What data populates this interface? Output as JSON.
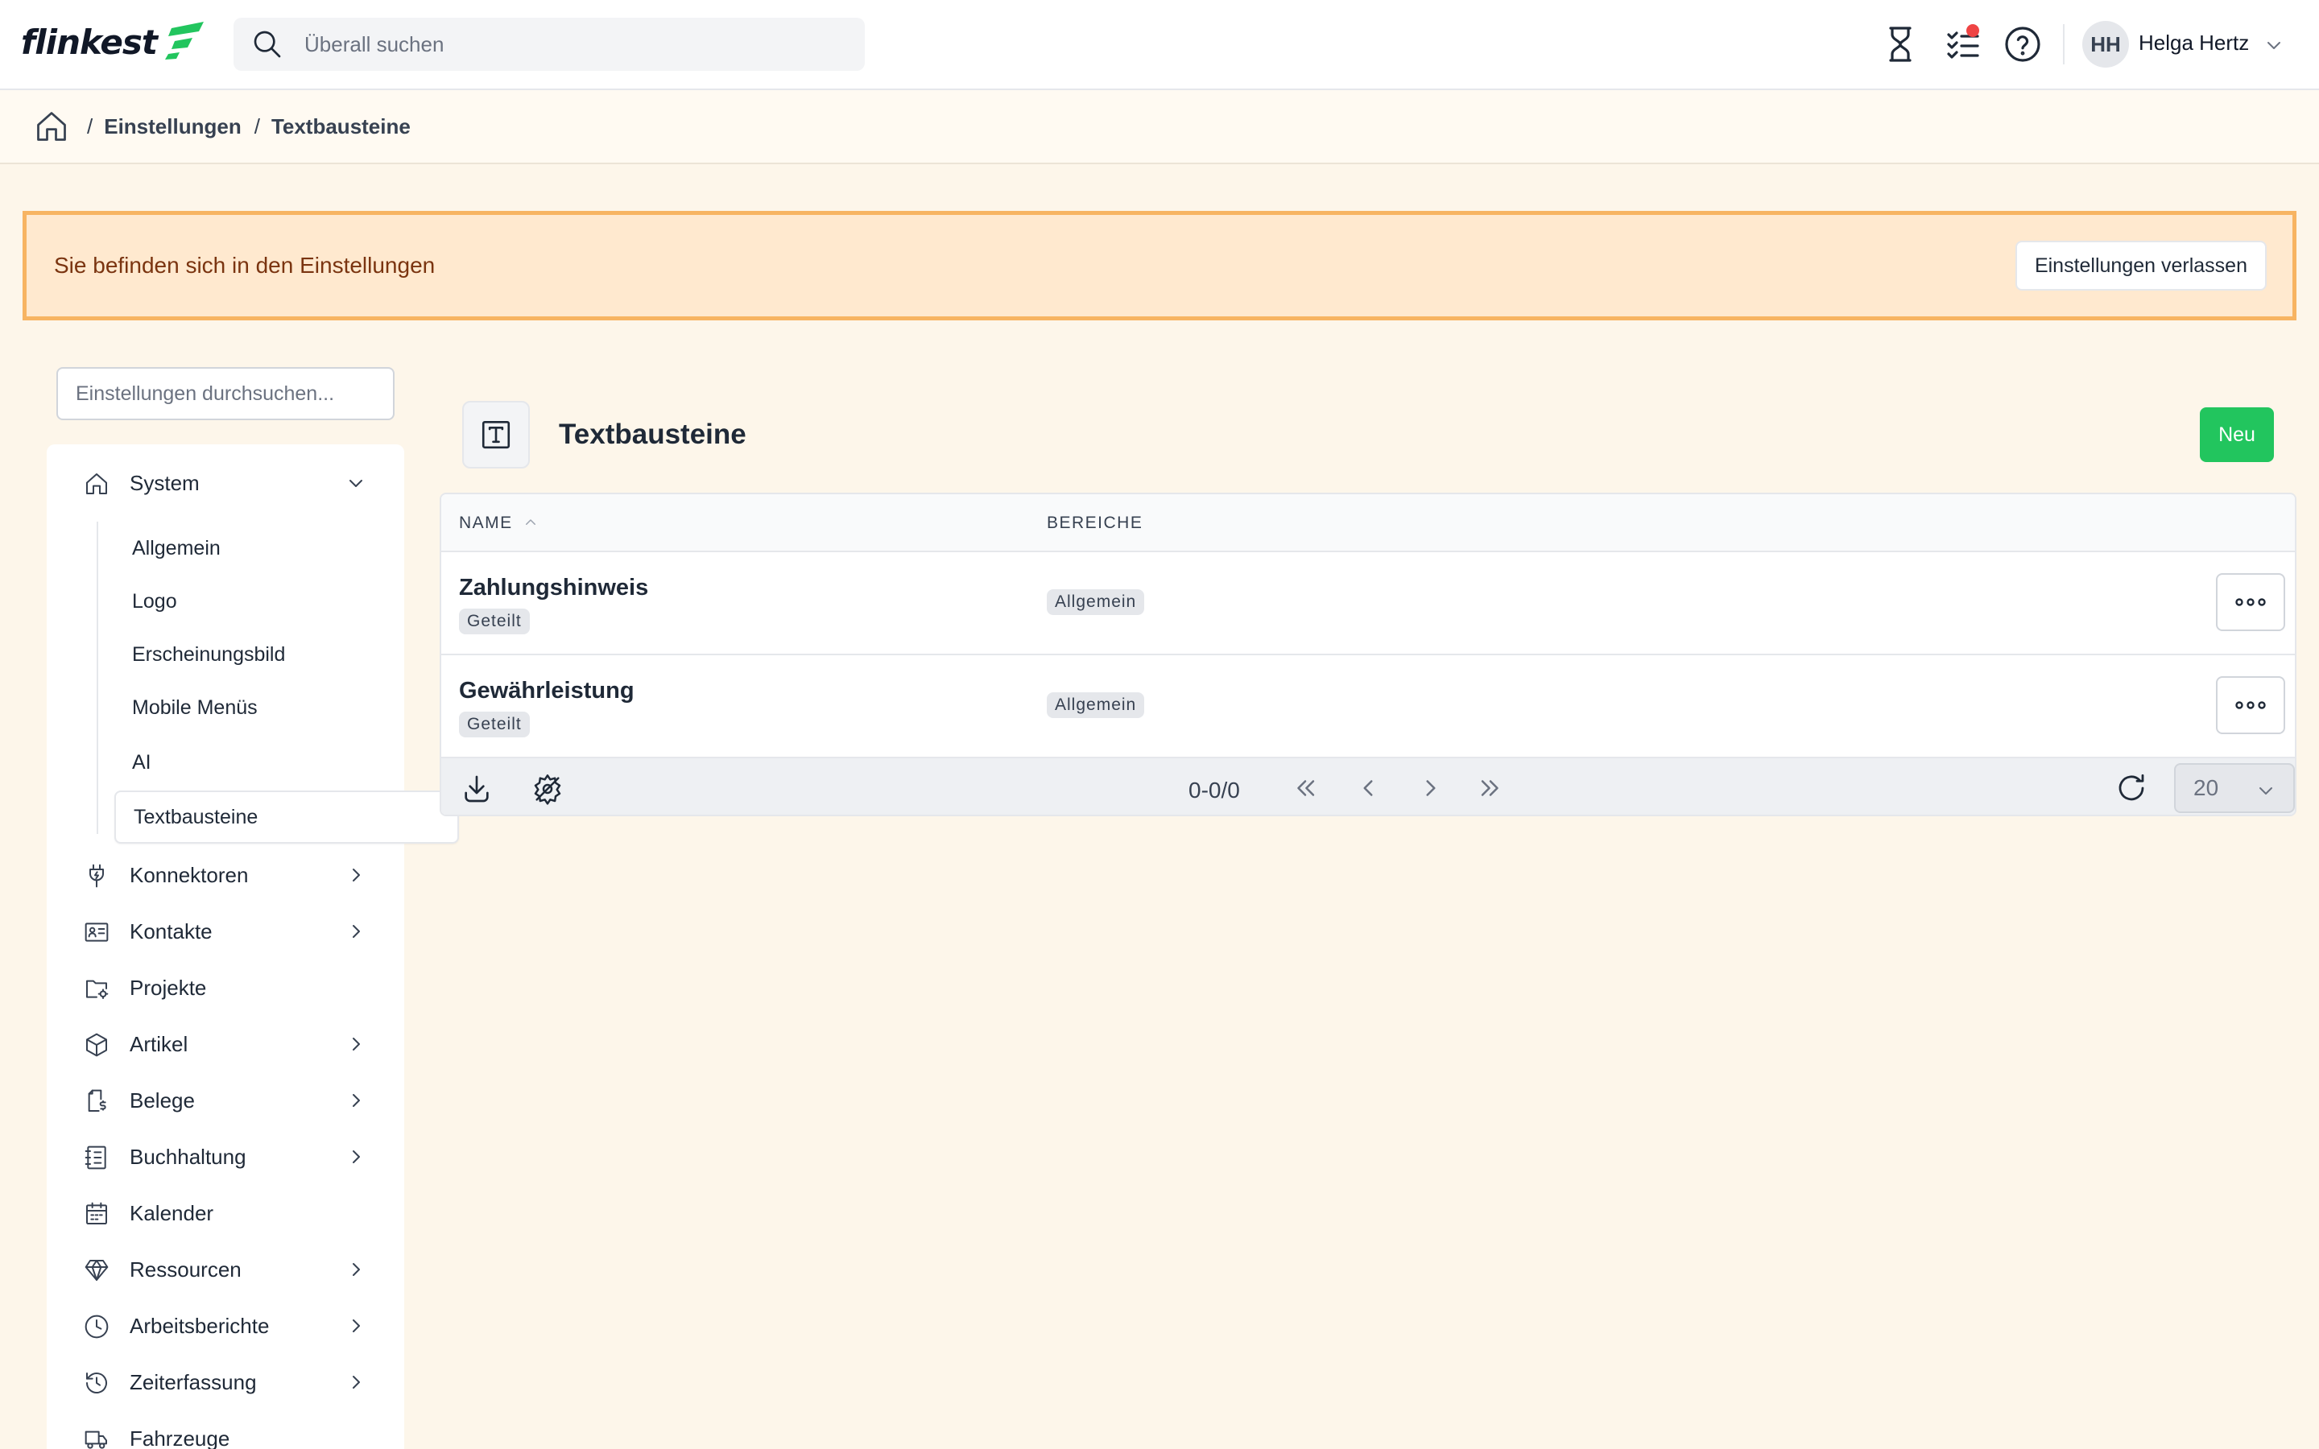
{
  "app": {
    "logo_text": "flinkest",
    "search_placeholder": "Überall suchen",
    "user": {
      "initials": "HH",
      "name": "Helga Hertz"
    },
    "icons": [
      "hourglass-icon",
      "tasks-icon",
      "help-icon"
    ],
    "notification_dot_color": "#ef4444"
  },
  "breadcrumb": {
    "items": [
      "Einstellungen",
      "Textbausteine"
    ],
    "separator": "/"
  },
  "banner": {
    "text": "Sie befinden sich in den Einstellungen",
    "button_label": "Einstellungen verlassen"
  },
  "sidebar": {
    "search_placeholder": "Einstellungen durchsuchen...",
    "system": {
      "label": "System",
      "children": [
        "Allgemein",
        "Logo",
        "Erscheinungsbild",
        "Mobile Menüs",
        "AI",
        "Textbausteine"
      ],
      "active": "Textbausteine"
    },
    "items": [
      {
        "label": "Konnektoren",
        "icon": "plug-icon",
        "has_children": true
      },
      {
        "label": "Kontakte",
        "icon": "contact-card-icon",
        "has_children": true
      },
      {
        "label": "Projekte",
        "icon": "folder-gear-icon",
        "has_children": false
      },
      {
        "label": "Artikel",
        "icon": "cube-icon",
        "has_children": true
      },
      {
        "label": "Belege",
        "icon": "receipt-icon",
        "has_children": true
      },
      {
        "label": "Buchhaltung",
        "icon": "ledger-icon",
        "has_children": true
      },
      {
        "label": "Kalender",
        "icon": "calendar-icon",
        "has_children": false
      },
      {
        "label": "Ressourcen",
        "icon": "gem-icon",
        "has_children": true
      },
      {
        "label": "Arbeitsberichte",
        "icon": "clock-icon",
        "has_children": true
      },
      {
        "label": "Zeiterfassung",
        "icon": "history-icon",
        "has_children": true
      },
      {
        "label": "Fahrzeuge",
        "icon": "truck-icon",
        "has_children": false
      }
    ]
  },
  "main": {
    "title": "Textbausteine",
    "new_button": "Neu",
    "table": {
      "columns": [
        "NAME",
        "BEREICHE"
      ],
      "sort": {
        "column": "NAME",
        "direction": "asc"
      },
      "rows": [
        {
          "name": "Zahlungshinweis",
          "tag": "Geteilt",
          "bereich": "Allgemein"
        },
        {
          "name": "Gewährleistung",
          "tag": "Geteilt",
          "bereich": "Allgemein"
        }
      ]
    },
    "pagination": {
      "info": "0-0/0",
      "page_size": "20"
    }
  },
  "colors": {
    "accent_green": "#22c55e",
    "banner_bg": "#ffe9cf",
    "banner_border": "#f7b462",
    "page_bg": "#fdf6ea"
  }
}
